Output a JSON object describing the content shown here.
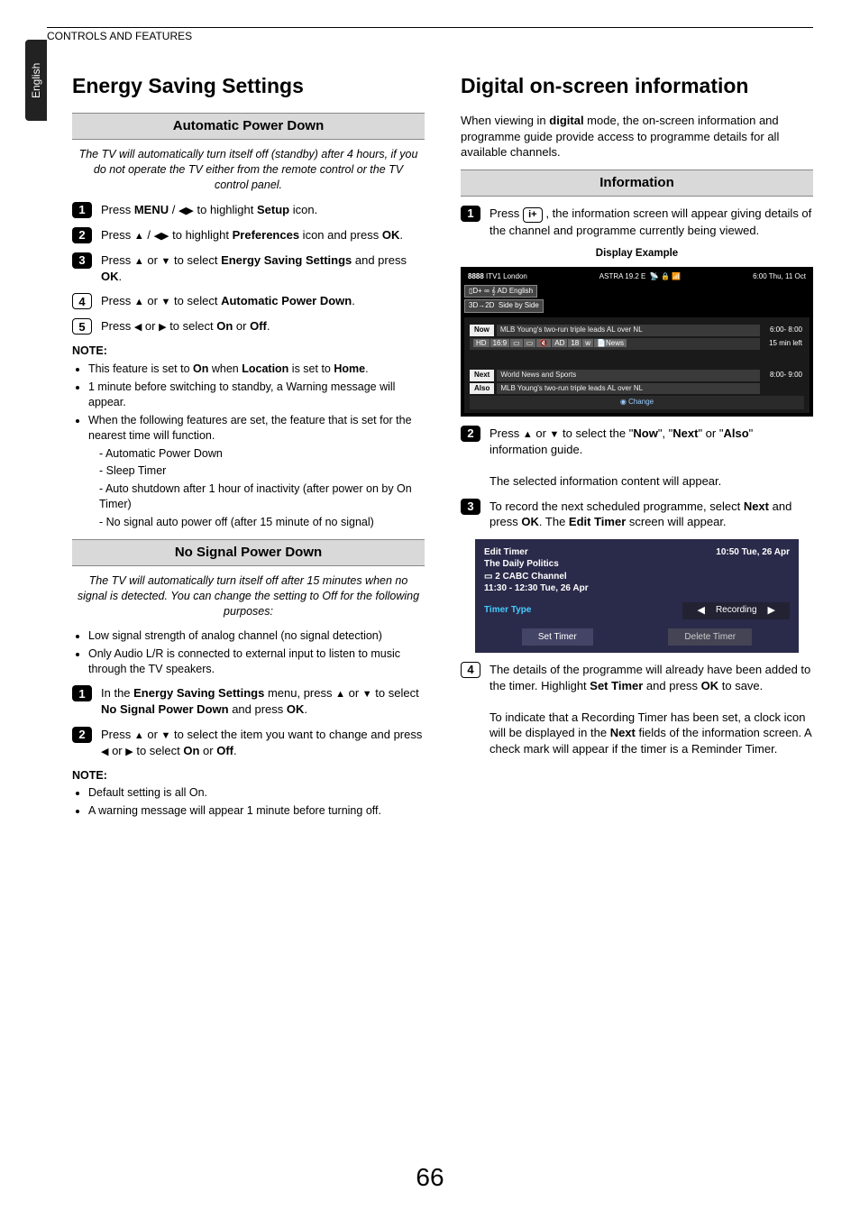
{
  "header": "CONTROLS AND FEATURES",
  "lang_tab": "English",
  "page_number": "66",
  "left": {
    "h1": "Energy Saving Settings",
    "auto_power": {
      "title": "Automatic Power Down",
      "intro": "The TV will automatically turn itself off (standby) after 4 hours, if you do not operate the TV either from the remote control or the TV control panel.",
      "steps": [
        "Press MENU / ◀▶ to highlight Setup icon.",
        "Press ▲ / ◀▶ to highlight Preferences icon and press OK.",
        "Press ▲ or ▼ to select Energy Saving Settings and press OK.",
        "Press ▲ or ▼ to select Automatic Power Down.",
        "Press ◀ or ▶ to select On or Off."
      ],
      "note_hd": "NOTE:",
      "notes": [
        "This feature is set to On when Location is set to Home.",
        "1 minute before switching to standby, a Warning message will appear.",
        "When the following features are set, the feature that is set for the nearest time will function."
      ],
      "subnotes": [
        "Automatic Power Down",
        "Sleep Timer",
        "Auto shutdown after 1 hour of inactivity (after power on by On Timer)",
        "No signal auto power off (after 15 minute of no signal)"
      ]
    },
    "no_signal": {
      "title": "No Signal Power Down",
      "intro": "The TV will automatically turn itself off after 15 minutes when no signal is detected. You can change the setting to Off for the following purposes:",
      "bullets": [
        "Low signal strength of analog channel (no signal detection)",
        "Only Audio L/R is connected to external input to listen to music through the TV speakers."
      ],
      "steps": [
        "In the Energy Saving Settings menu, press ▲ or ▼ to select No Signal Power Down and press OK.",
        "Press ▲ or ▼ to select the item you want to change and press ◀ or ▶ to select On or Off."
      ],
      "note_hd": "NOTE:",
      "notes": [
        "Default setting is all On.",
        "A warning message will appear 1 minute before turning off."
      ]
    }
  },
  "right": {
    "h1": "Digital on-screen information",
    "intro": "When viewing in digital mode, the on-screen information and programme guide provide access to programme details for all available channels.",
    "info": {
      "title": "Information",
      "step1": "Press  i+ , the information screen will appear giving details of the channel and programme currently being viewed.",
      "display_example": "Display Example",
      "osd": {
        "ch_num": "8888",
        "ch_name": "ITV1 London",
        "sat": "ASTRA 19.2 E",
        "clock": "6:00 Thu, 11 Oct",
        "tags_line1": [
          "D+",
          "∞",
          "AD English"
        ],
        "tags_line2": [
          "3D→2D",
          "Side by Side"
        ],
        "now_lbl": "Now",
        "now_title": "MLB Young's two-run triple leads AL over NL",
        "now_time": "6:00- 8:00",
        "badges": [
          "HD",
          "16:9",
          "▭",
          "▭",
          "🔇",
          "AD",
          "18",
          "ᴡ",
          "News"
        ],
        "badge_right": "15 min left",
        "next_lbl": "Next",
        "next_title": "World News and Sports",
        "next_time": "8:00- 9:00",
        "also_lbl": "Also",
        "also_title": "MLB Young's two-run triple leads AL over NL",
        "change": "Change"
      },
      "step2": "Press ▲ or ▼ to select the \"Now\", \"Next\" or \"Also\" information guide.",
      "step2b": "The selected information content will appear.",
      "step3": "To record the next scheduled programme, select Next and press OK. The Edit Timer screen will appear.",
      "edit_timer": {
        "title": "Edit Timer",
        "prog": "The Daily Politics",
        "ch": "2 CABC Channel",
        "slot": "11:30 - 12:30 Tue, 26 Apr",
        "clock": "10:50 Tue, 26 Apr",
        "type_label": "Timer Type",
        "type_value": "Recording",
        "btn_set": "Set Timer",
        "btn_del": "Delete Timer"
      },
      "step4a": "The details of the programme will already have been added to the timer. Highlight Set Timer and press OK to save.",
      "step4b": "To indicate that a Recording Timer has been set, a clock icon will be displayed in the Next fields of the information screen. A check mark will appear if the timer is a Reminder Timer."
    }
  }
}
